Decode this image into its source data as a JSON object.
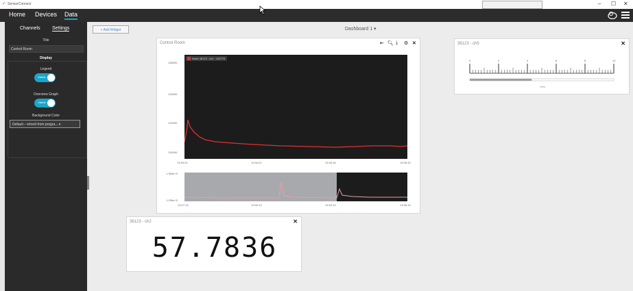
{
  "window": {
    "title": "SensorConnect",
    "minimize": "–",
    "maximize": "☐",
    "close": "✕"
  },
  "menu": {
    "home": "Home",
    "devices": "Devices",
    "data": "Data"
  },
  "sidebar": {
    "tabs": {
      "channels": "Channels",
      "settings": "Settings"
    },
    "title_label": "Title",
    "title_value": "Control Room",
    "display_heading": "Display",
    "legend_label": "Legend",
    "legend_toggle": "Visible",
    "overview_label": "Overview Graph",
    "overview_toggle": "Visible",
    "bg_label": "Background Color",
    "bg_value": "Default – inherit from progra... ▾"
  },
  "toolbar": {
    "add_widget": "+ Add Widget",
    "dashboard": "Dashboard 1 ▾"
  },
  "graph_widget": {
    "title": "Control Room",
    "legend_entry": "Node 36123 : ch1 : 133776",
    "series_color": "#e03030",
    "y_ticks": [
      "136000",
      "134000",
      "132000",
      "130000"
    ],
    "x_ticks": [
      "13:33:24",
      "13:34:21",
      "13:35:18",
      "13:36:15"
    ],
    "overview_y_ticks": [
      "1.366e+5",
      "1.296e+5"
    ],
    "overview_x_ticks": [
      "13:27:13",
      "13:30:13",
      "13:33:14",
      "13:36:15"
    ]
  },
  "ruler_widget": {
    "title": "36123 - ch5",
    "ticks": [
      "0",
      "2",
      "4",
      "6",
      "8",
      "10"
    ],
    "unit": "Volts",
    "value_fraction": 0.43
  },
  "number_widget": {
    "title": "36123 - ch2",
    "value": "57.7836"
  }
}
